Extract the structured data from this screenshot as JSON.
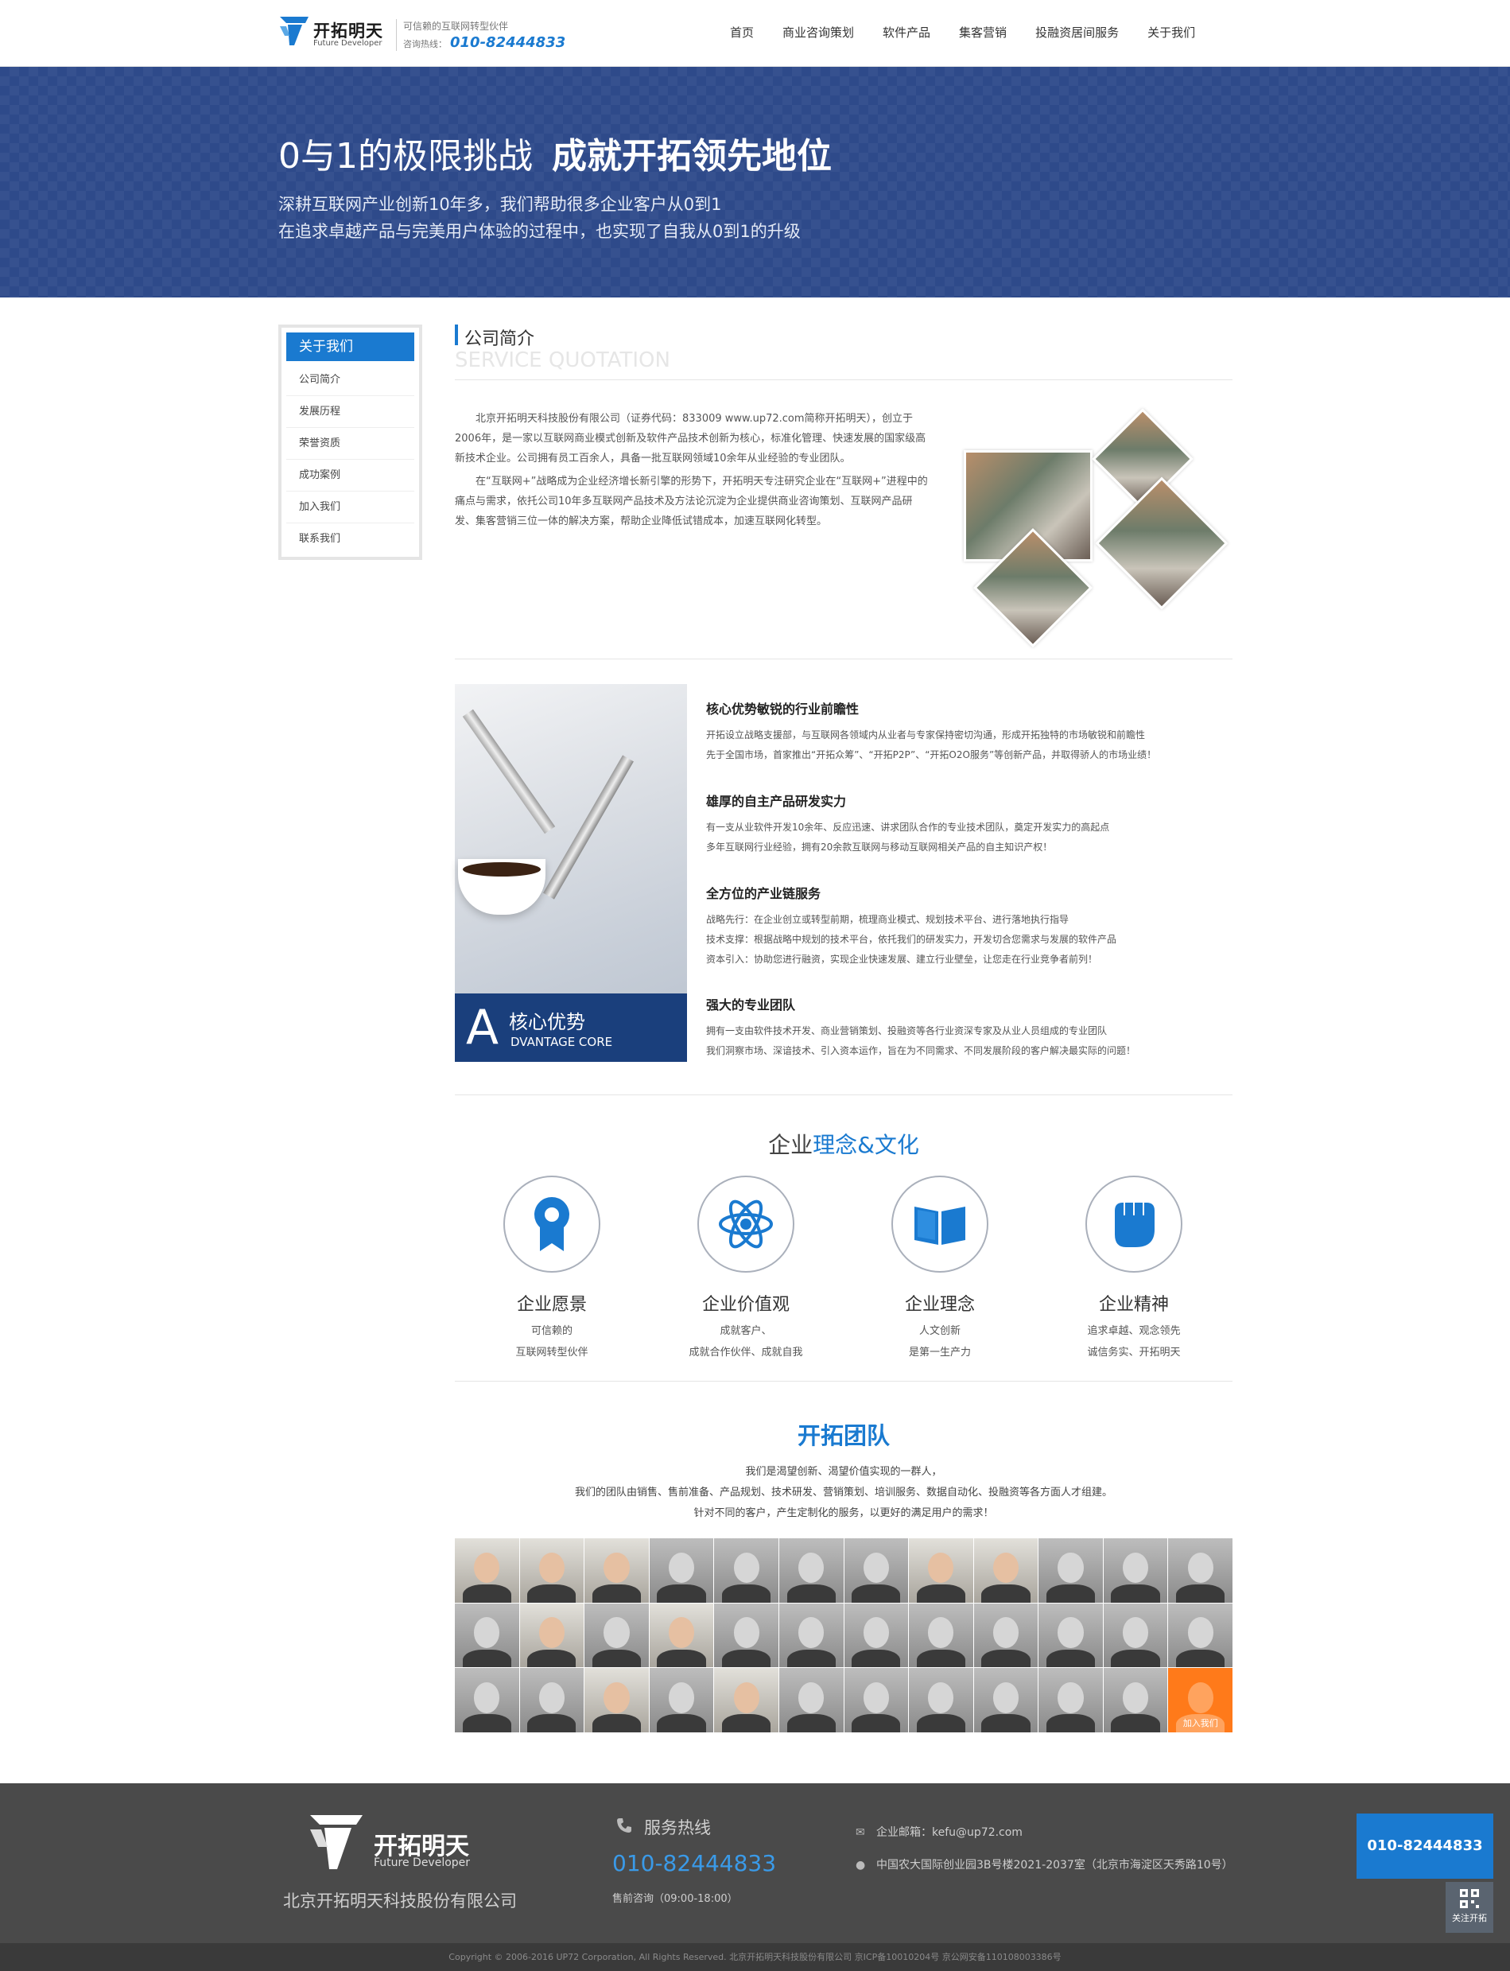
{
  "header": {
    "logo_cn": "开拓明天",
    "logo_en": "Future Developer",
    "tagline": "可信赖的互联网转型伙伴",
    "hotline_label": "咨询热线：",
    "hotline": "010-82444833",
    "nav": [
      "首页",
      "商业咨询策划",
      "软件产品",
      "集客营销",
      "投融资居间服务",
      "关于我们"
    ]
  },
  "banner": {
    "title_light": "0与1的极限挑战",
    "title_bold": "成就开拓领先地位",
    "line1": "深耕互联网产业创新10年多，我们帮助很多企业客户从0到1",
    "line2": "在追求卓越产品与完美用户体验的过程中，也实现了自我从0到1的升级"
  },
  "sidebar": {
    "head": "关于我们",
    "items": [
      "公司简介",
      "发展历程",
      "荣誉资质",
      "成功案例",
      "加入我们",
      "联系我们"
    ]
  },
  "intro": {
    "title_cn": "公司简介",
    "title_en": "SERVICE QUOTATION",
    "p1": "北京开拓明天科技股份有限公司（证券代码：833009 www.up72.com简称开拓明天），创立于2006年，是一家以互联网商业模式创新及软件产品技术创新为核心，标准化管理、快速发展的国家级高新技术企业。公司拥有员工百余人，具备一批互联网领域10余年从业经验的专业团队。",
    "p2": "在“互联网+”战略成为企业经济增长新引擎的形势下，开拓明天专注研究企业在“互联网+”进程中的痛点与需求，依托公司10年多互联网产品技术及方法论沉淀为企业提供商业咨询策划、互联网产品研发、集客营销三位一体的解决方案，帮助企业降低试错成本，加速互联网化转型。"
  },
  "advantage": {
    "big_letter": "A",
    "caption_cn": "核心优势",
    "caption_en": "DVANTAGE CORE",
    "items": [
      {
        "title": "核心优势敏锐的行业前瞻性",
        "lines": [
          "开拓设立战略支援部，与互联网各领域内从业者与专家保持密切沟通，形成开拓独特的市场敏锐和前瞻性",
          "先于全国市场，首家推出“开拓众筹”、“开拓P2P”、“开拓O2O服务”等创新产品，并取得骄人的市场业绩！"
        ]
      },
      {
        "title": "雄厚的自主产品研发实力",
        "lines": [
          "有一支从业软件开发10余年、反应迅速、讲求团队合作的专业技术团队，奠定开发实力的高起点",
          "多年互联网行业经验，拥有20余款互联网与移动互联网相关产品的自主知识产权！"
        ]
      },
      {
        "title": "全方位的产业链服务",
        "lines": [
          "战略先行：在企业创立或转型前期，梳理商业模式、规划技术平台、进行落地执行指导",
          "技术支撑：根据战略中规划的技术平台，依托我们的研发实力，开发切合您需求与发展的软件产品",
          "资本引入：协助您进行融资，实现企业快速发展、建立行业壁垒，让您走在行业竞争者前列！"
        ]
      },
      {
        "title": "强大的专业团队",
        "lines": [
          "拥有一支由软件技术开发、商业营销策划、投融资等各行业资深专家及从业人员组成的专业团队",
          "我们洞察市场、深谙技术、引入资本运作，旨在为不同需求、不同发展阶段的客户解决最实际的问题！"
        ]
      }
    ]
  },
  "culture": {
    "title_pre": "企业",
    "title_hl": "理念&文化",
    "items": [
      {
        "icon": "award-icon",
        "title": "企业愿景",
        "l1": "可信赖的",
        "l2": "互联网转型伙伴"
      },
      {
        "icon": "atom-icon",
        "title": "企业价值观",
        "l1": "成就客户、",
        "l2": "成就合作伙伴、成就自我"
      },
      {
        "icon": "book-icon",
        "title": "企业理念",
        "l1": "人文创新",
        "l2": "是第一生产力"
      },
      {
        "icon": "fist-icon",
        "title": "企业精神",
        "l1": "追求卓越、观念领先",
        "l2": "诚信务实、开拓明天"
      }
    ],
    "accent": "#1a7ad0"
  },
  "team": {
    "title": "开拓团队",
    "l1": "我们是渴望创新、渴望价值实现的一群人，",
    "l2": "我们的团队由销售、售前准备、产品规划、技术研发、营销策划、培训服务、数据自动化、投融资等各方面人才组建。",
    "l3": "针对不同的客户，产生定制化的服务，以更好的满足用户的需求！",
    "join": "加入我们"
  },
  "footer": {
    "logo_cn": "开拓明天",
    "logo_en": "Future Developer",
    "company": "北京开拓明天科技股份有限公司",
    "hot_label": "服务热线",
    "phone": "010-82444833",
    "hours": "售前咨询（09:00-18:00）",
    "email": "企业邮箱：kefu@up72.com",
    "address": "中国农大国际创业园3B号楼2021-2037室（北京市海淀区天秀路10号）",
    "copyright": "Copyright © 2006-2016 UP72 Corporation, All Rights Reserved. 北京开拓明天科技股份有限公司 京ICP备10010204号 京公网安备110108003386号",
    "float_phone": "010-82444833",
    "qr_label": "关注开拓"
  }
}
